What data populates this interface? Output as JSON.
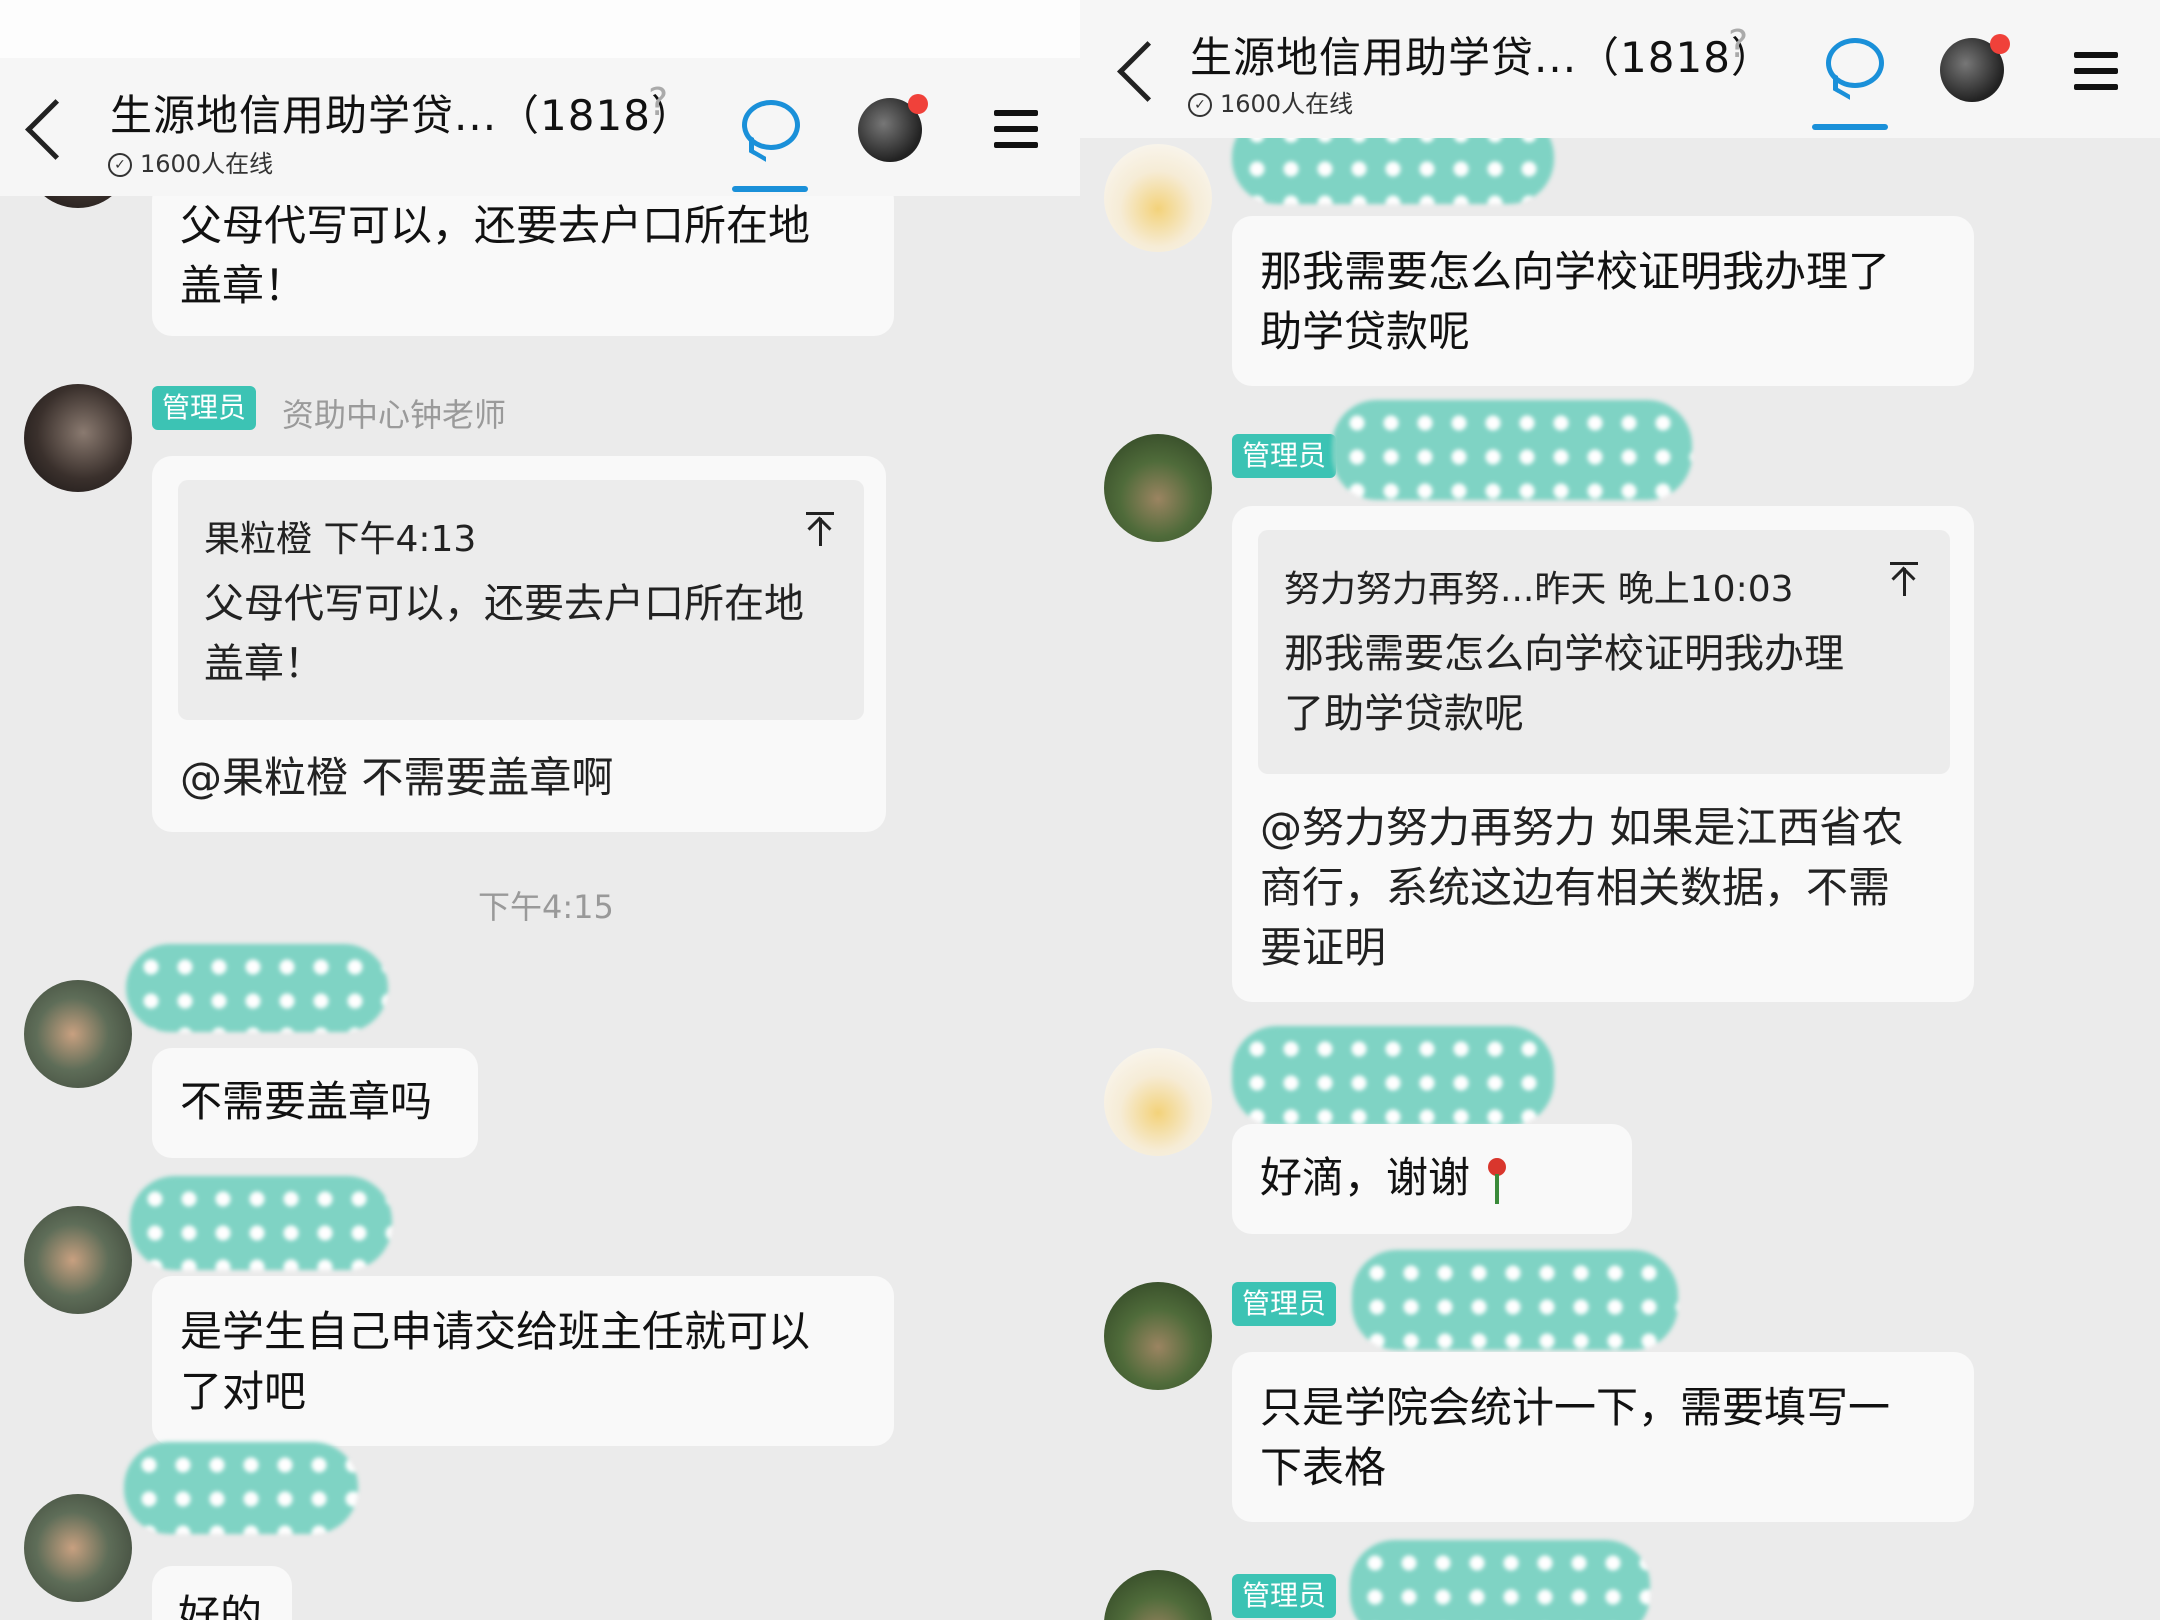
{
  "header": {
    "title": "生源地信用助学贷...（1818）",
    "online": "1600人在线"
  },
  "left": {
    "top_message": "父母代写可以，还要去户口所在地\n盖章！",
    "admin_badge": "管理员",
    "admin_sender": "资助中心钟老师",
    "quote_header": "果粒橙  下午4:13",
    "quote_text": "父母代写可以，还要去户口所在地\n盖章！",
    "reply_text": "@果粒橙 不需要盖章啊",
    "timestamp": "下午4:15",
    "msg1": "不需要盖章吗",
    "msg2": "是学生自己申请交给班主任就可以\n了对吧",
    "msg3": "好的"
  },
  "right": {
    "msg1": "那我需要怎么向学校证明我办理了\n助学贷款呢",
    "admin_badge1": "管理员",
    "quote_header": "努力努力再努...昨天 晚上10:03",
    "quote_text": "那我需要怎么向学校证明我办理\n了助学贷款呢",
    "reply_text": "@努力努力再努力 如果是江西省农\n商行，系统这边有相关数据，不需\n要证明",
    "msg2": "好滴，谢谢",
    "admin_badge2": "管理员",
    "msg3": "只是学院会统计一下，需要填写一\n下表格",
    "admin_badge3": "管理员"
  },
  "icons": {
    "back": "back-chevron-icon",
    "listen": "ear-icon",
    "chat": "chat-bubble-icon",
    "menu": "hamburger-menu-icon",
    "pin": "pin-to-top-icon",
    "check": "check-circle-icon",
    "flower": "rose-emoji"
  },
  "colors": {
    "accent": "#1a90d9",
    "badge": "#3cc3b4",
    "notification": "#f0413a"
  }
}
